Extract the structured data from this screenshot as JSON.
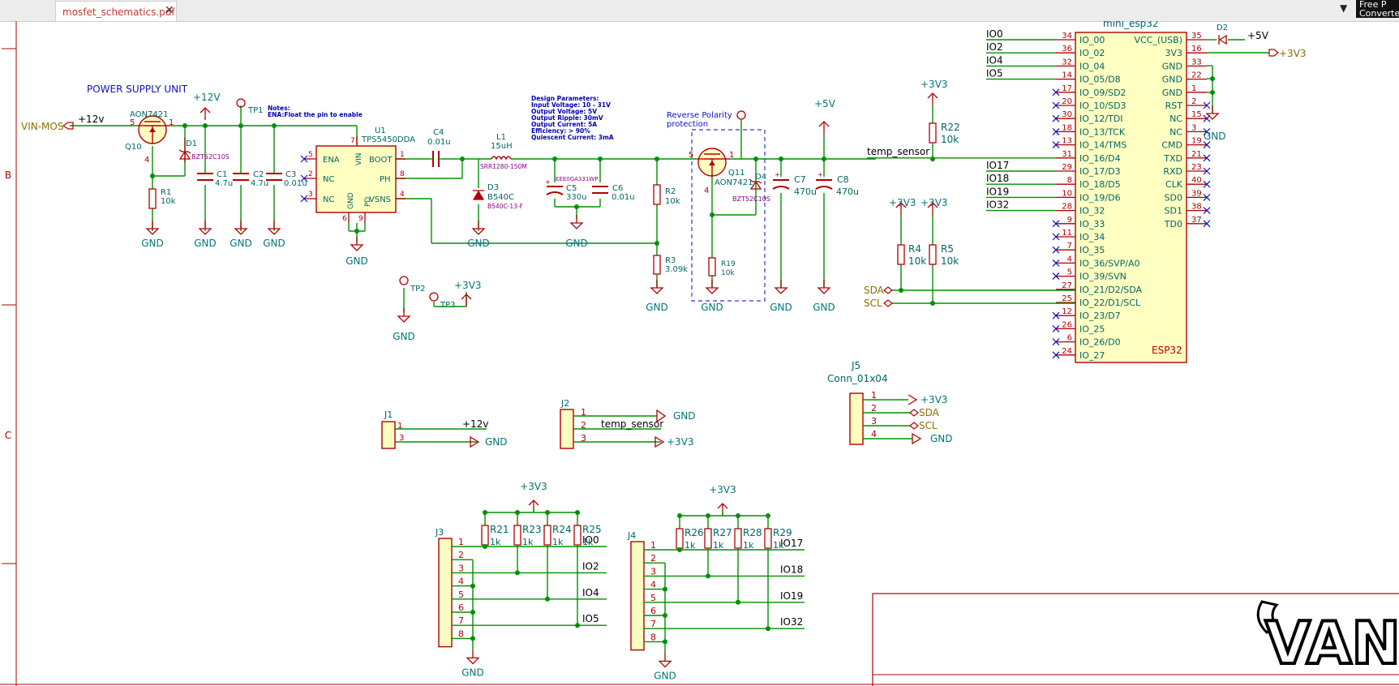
{
  "tab": {
    "title": "mosfet_schematics.pdf",
    "close": "✕"
  },
  "toolbar": {
    "dropdown_icon": "chevron-down-icon",
    "promo_line1": "Free P",
    "promo_line2": "Converte"
  },
  "colors": {
    "wire": "#009000",
    "symbol": "#b00000",
    "label": "#007777",
    "fill": "#ffffc2",
    "ref": "#006666",
    "note": "#0000aa",
    "value_alt": "#880088"
  },
  "border": {
    "row_b": "B",
    "row_c": "C"
  },
  "psu": {
    "title": "POWER SUPPLY UNIT",
    "vin_label": "VIN-MOS",
    "v12_net": "+12v",
    "v12_power": "+12V",
    "notes_line1": "Notes:",
    "notes_line2": "ENA:Float the pin to enable",
    "q10_value": "AON7421",
    "q10_ref": "Q10",
    "q10_pin5": "5",
    "q10_pin1": "1",
    "q10_pin4": "4",
    "d1_ref": "D1",
    "d1_value": "BZT52C10S",
    "r1_ref": "R1",
    "r1_value": "10k",
    "c1_ref": "C1",
    "c1_value": "4.7u",
    "c2_ref": "C2",
    "c2_value": "4.7u",
    "c3_ref": "C3",
    "c3_value": "0.01u",
    "tp1": "TP1",
    "tp2": "TP2",
    "tp3": "TP3",
    "tp3_power": "+3V3",
    "u1_ref": "U1",
    "u1_value": "TPS5450DDA",
    "u1_pins": {
      "ena": "ENA",
      "nc1": "NC",
      "nc2": "NC",
      "vin": "VIN",
      "gnd": "GND",
      "pd": "PD",
      "boot": "BOOT",
      "ph": "PH",
      "vsns": "VSNS"
    },
    "u1_pin_numbers": {
      "p5": "5",
      "p2": "2",
      "p3": "3",
      "p7": "7",
      "p1": "1",
      "p8": "8",
      "p4": "4",
      "p6": "6",
      "p9": "9"
    },
    "c4_ref": "C4",
    "c4_value": "0.01u",
    "l1_ref": "L1",
    "l1_value": "15uH",
    "l1_part": "SRR1280-150M",
    "d3_ref": "D3",
    "d3_value": "B540C",
    "d3_part": "B540C-13-F",
    "c5_ref": "C5",
    "c5_value": "330u",
    "c5_part": "EEE0GA331WP",
    "c6_ref": "C6",
    "c6_value": "0.01u",
    "design_params": [
      "Design Parameters:",
      "Input Voltage: 10 - 31V",
      "Output Voltage: 5V",
      "Output Ripple: 30mV",
      "Output Current: 5A",
      "Efficiency: > 90%",
      "Quiescent Current: 3mA"
    ],
    "r2_ref": "R2",
    "r2_value": "10k",
    "r3_ref": "R3",
    "r3_value": "3.09k",
    "rp_title1": "Reverse Polarity",
    "rp_title2": "protection",
    "q11_ref": "Q11",
    "q11_value": "AON7421",
    "q11_pin5": "5",
    "q11_pin1": "1",
    "q11_pin4": "4",
    "d4_ref": "D4",
    "d4_value": "BZT52C10S",
    "r19_ref": "R19",
    "r19_value": "10k",
    "v5_power": "+5V",
    "c7_ref": "C7",
    "c7_value": "470u",
    "c8_ref": "C8",
    "c8_value": "470u",
    "gnd": "GND"
  },
  "esp": {
    "title": "mini_esp32",
    "footer": "ESP32",
    "left_pins": [
      {
        "name": "IO_00",
        "num": "34",
        "net": "IO0"
      },
      {
        "name": "IO_02",
        "num": "36",
        "net": "IO2"
      },
      {
        "name": "IO_04",
        "num": "32",
        "net": "IO4"
      },
      {
        "name": "IO_05/D8",
        "num": "14",
        "net": "IO5"
      },
      {
        "name": "IO_09/SD2",
        "num": "17",
        "net": ""
      },
      {
        "name": "IO_10/SD3",
        "num": "20",
        "net": ""
      },
      {
        "name": "IO_12/TDI",
        "num": "30",
        "net": ""
      },
      {
        "name": "IO_13/TCK",
        "num": "18",
        "net": ""
      },
      {
        "name": "IO_14/TMS",
        "num": "13",
        "net": ""
      },
      {
        "name": "IO_16/D4",
        "num": "31",
        "net": "temp_sensor"
      },
      {
        "name": "IO_17/D3",
        "num": "29",
        "net": "IO17"
      },
      {
        "name": "IO_18/D5",
        "num": "8",
        "net": "IO18"
      },
      {
        "name": "IO_19/D6",
        "num": "10",
        "net": "IO19"
      },
      {
        "name": "IO_32",
        "num": "28",
        "net": "IO32"
      },
      {
        "name": "IO_33",
        "num": "9",
        "net": ""
      },
      {
        "name": "IO_34",
        "num": "11",
        "net": ""
      },
      {
        "name": "IO_35",
        "num": "7",
        "net": ""
      },
      {
        "name": "IO_36/SVP/A0",
        "num": "4",
        "net": ""
      },
      {
        "name": "IO_39/SVN",
        "num": "5",
        "net": ""
      },
      {
        "name": "IO_21/D2/SDA",
        "num": "27",
        "net": "SDA"
      },
      {
        "name": "IO_22/D1/SCL",
        "num": "25",
        "net": "SCL"
      },
      {
        "name": "IO_23/D7",
        "num": "12",
        "net": ""
      },
      {
        "name": "IO_25",
        "num": "26",
        "net": ""
      },
      {
        "name": "IO_26/D0",
        "num": "6",
        "net": ""
      },
      {
        "name": "IO_27",
        "num": "24",
        "net": ""
      }
    ],
    "right_pins": [
      {
        "name": "VCC_(USB)",
        "num": "35"
      },
      {
        "name": "3V3",
        "num": "16"
      },
      {
        "name": "GND",
        "num": "33"
      },
      {
        "name": "GND",
        "num": "22"
      },
      {
        "name": "GND",
        "num": "1"
      },
      {
        "name": "RST",
        "num": "2"
      },
      {
        "name": "NC",
        "num": "15"
      },
      {
        "name": "NC",
        "num": "3"
      },
      {
        "name": "CMD",
        "num": "19"
      },
      {
        "name": "TXD",
        "num": "21"
      },
      {
        "name": "RXD",
        "num": "23"
      },
      {
        "name": "CLK",
        "num": "40"
      },
      {
        "name": "SD0",
        "num": "39"
      },
      {
        "name": "SD1",
        "num": "38"
      },
      {
        "name": "TD0",
        "num": "37"
      }
    ],
    "d2_ref": "D2",
    "p5v": "+5V",
    "p3v3": "+3V3",
    "gnd": "GND",
    "r22_power": "+3V3",
    "r22_ref": "R22",
    "r22_value": "10k",
    "r4_power": "+3V3",
    "r4_ref": "R4",
    "r4_value": "10k",
    "r5_power": "+3V3",
    "r5_ref": "R5",
    "r5_value": "10k",
    "sda_label": "SDA",
    "scl_label": "SCL"
  },
  "connectors": {
    "j1": {
      "ref": "J1",
      "pins": [
        "1",
        "3"
      ],
      "nets": [
        "+12v",
        "GND"
      ]
    },
    "j2": {
      "ref": "J2",
      "pins": [
        "1",
        "2",
        "3"
      ],
      "nets": [
        "GND",
        "temp_sensor",
        "+3V3"
      ]
    },
    "j5": {
      "ref": "J5",
      "value": "Conn_01x04",
      "pins": [
        "1",
        "2",
        "3",
        "4"
      ],
      "nets": [
        "+3V3",
        "SDA",
        "SCL",
        "GND"
      ]
    },
    "j3": {
      "ref": "J3",
      "pins": [
        "1",
        "2",
        "3",
        "4",
        "5",
        "6",
        "7",
        "8"
      ],
      "nets": [
        "IO0",
        "IO2",
        "IO4",
        "IO5"
      ],
      "power": "+3V3",
      "gnd": "GND",
      "resistors": [
        {
          "ref": "R21",
          "value": "1k"
        },
        {
          "ref": "R23",
          "value": "1k"
        },
        {
          "ref": "R24",
          "value": "1k"
        },
        {
          "ref": "R25",
          "value": "1k"
        }
      ]
    },
    "j4": {
      "ref": "J4",
      "pins": [
        "1",
        "2",
        "3",
        "4",
        "5",
        "6",
        "7",
        "8"
      ],
      "nets": [
        "IO17",
        "IO18",
        "IO19",
        "IO32"
      ],
      "power": "+3V3",
      "gnd": "GND",
      "resistors": [
        {
          "ref": "R26",
          "value": "1k"
        },
        {
          "ref": "R27",
          "value": "1k"
        },
        {
          "ref": "R28",
          "value": "1k"
        },
        {
          "ref": "R29",
          "value": "1k"
        }
      ]
    }
  },
  "titleblock": {
    "logo_text": "VANP"
  }
}
